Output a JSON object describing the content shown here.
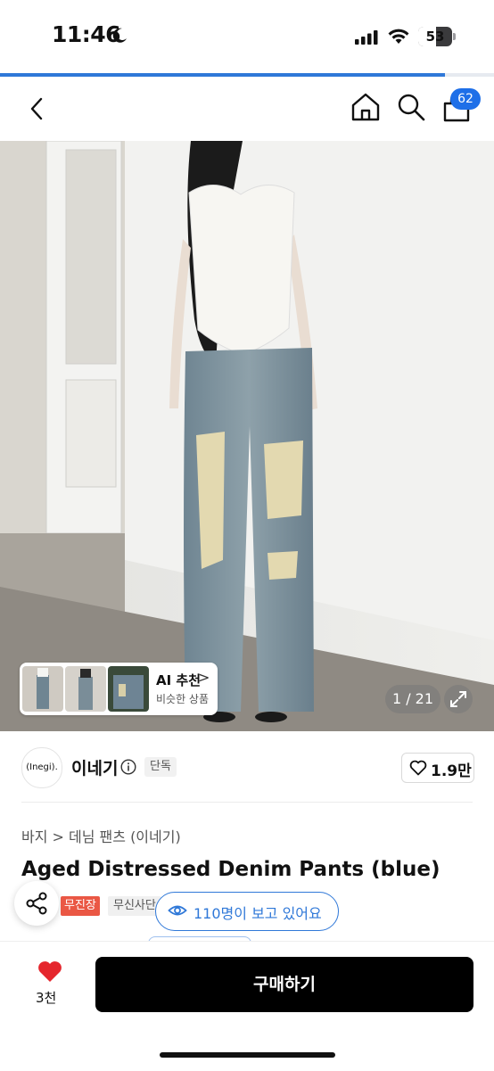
{
  "status_bar": {
    "time": "11:46",
    "battery": "53"
  },
  "page_load_progress": 0.9,
  "nav": {
    "cart_badge": "62"
  },
  "gallery": {
    "ai_title": "AI 추천",
    "ai_chevron": ">",
    "ai_subtitle": "비슷한 상품",
    "counter": "1 / 21"
  },
  "brand": {
    "logo_text": "(Inegi).",
    "name": "이네기",
    "exclusive_tag": "단독",
    "likes": "1.9만"
  },
  "product": {
    "breadcrumb": "바지 > 데님 팬츠 (이네기)",
    "title": "Aged Distressed Denim Pants (blue)",
    "tags": [
      "무진장",
      "무신사단"
    ],
    "viewers": "110명이 보고 있어요"
  },
  "bottom": {
    "wishlist_count": "3천",
    "buy_label": "구매하기"
  },
  "colors": {
    "accent": "#2f78d8",
    "sale_tag": "#ea5744",
    "heart": "#e5262d",
    "buy": "#000000"
  },
  "icons": [
    "moon-icon",
    "signal-icon",
    "wifi-icon",
    "back-icon",
    "home-icon",
    "search-icon",
    "cart-icon",
    "expand-icon",
    "info-icon",
    "heart-outline-icon",
    "share-icon",
    "eye-icon",
    "heart-filled-icon"
  ]
}
